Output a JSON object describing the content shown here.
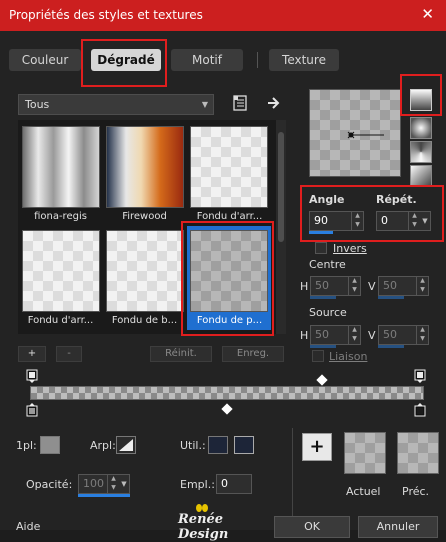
{
  "window": {
    "title": "Propriétés des styles et textures",
    "close_glyph": "✕"
  },
  "tabs": [
    "Couleur",
    "Dégradé",
    "Motif",
    "Texture"
  ],
  "category": {
    "value": "Tous"
  },
  "gallery": [
    {
      "name": "fiona-regis"
    },
    {
      "name": "Firewood"
    },
    {
      "name": "Fondu d'arr..."
    },
    {
      "name": "Fondu d'arr..."
    },
    {
      "name": "Fondu de b..."
    },
    {
      "name": "Fondu de p..."
    }
  ],
  "gallery_buttons": {
    "add": "+",
    "remove": "-",
    "reset": "Réinit.",
    "save": "Enreg."
  },
  "gradient_controls": {
    "angle_label": "Angle",
    "angle_value": "90",
    "repeat_label": "Répét.",
    "repeat_value": "0",
    "invert_label": "Invers",
    "center_label": "Centre",
    "center_h_label": "H",
    "center_h": "50",
    "center_v_label": "V",
    "center_v": "50",
    "source_label": "Source",
    "source_h_label": "H",
    "source_h": "50",
    "source_v_label": "V",
    "source_v": "50",
    "link_label": "Liaison"
  },
  "bottom": {
    "pos_label": "1pl:",
    "arpl_label": "Arpl:",
    "util_label": "Util.:",
    "opacity_label": "Opacité:",
    "opacity_value": "100",
    "empl_label": "Empl.:",
    "empl_value": "0",
    "current_label": "Actuel",
    "previous_label": "Préc.",
    "add_glyph": "+"
  },
  "footer": {
    "help": "Aide",
    "watermark": "Renée Design",
    "ok": "OK",
    "cancel": "Annuler"
  },
  "colors": {
    "title_bar": "#cc1f1f",
    "highlight_red": "#e01e1e",
    "selection_blue": "#1f6fd0"
  }
}
